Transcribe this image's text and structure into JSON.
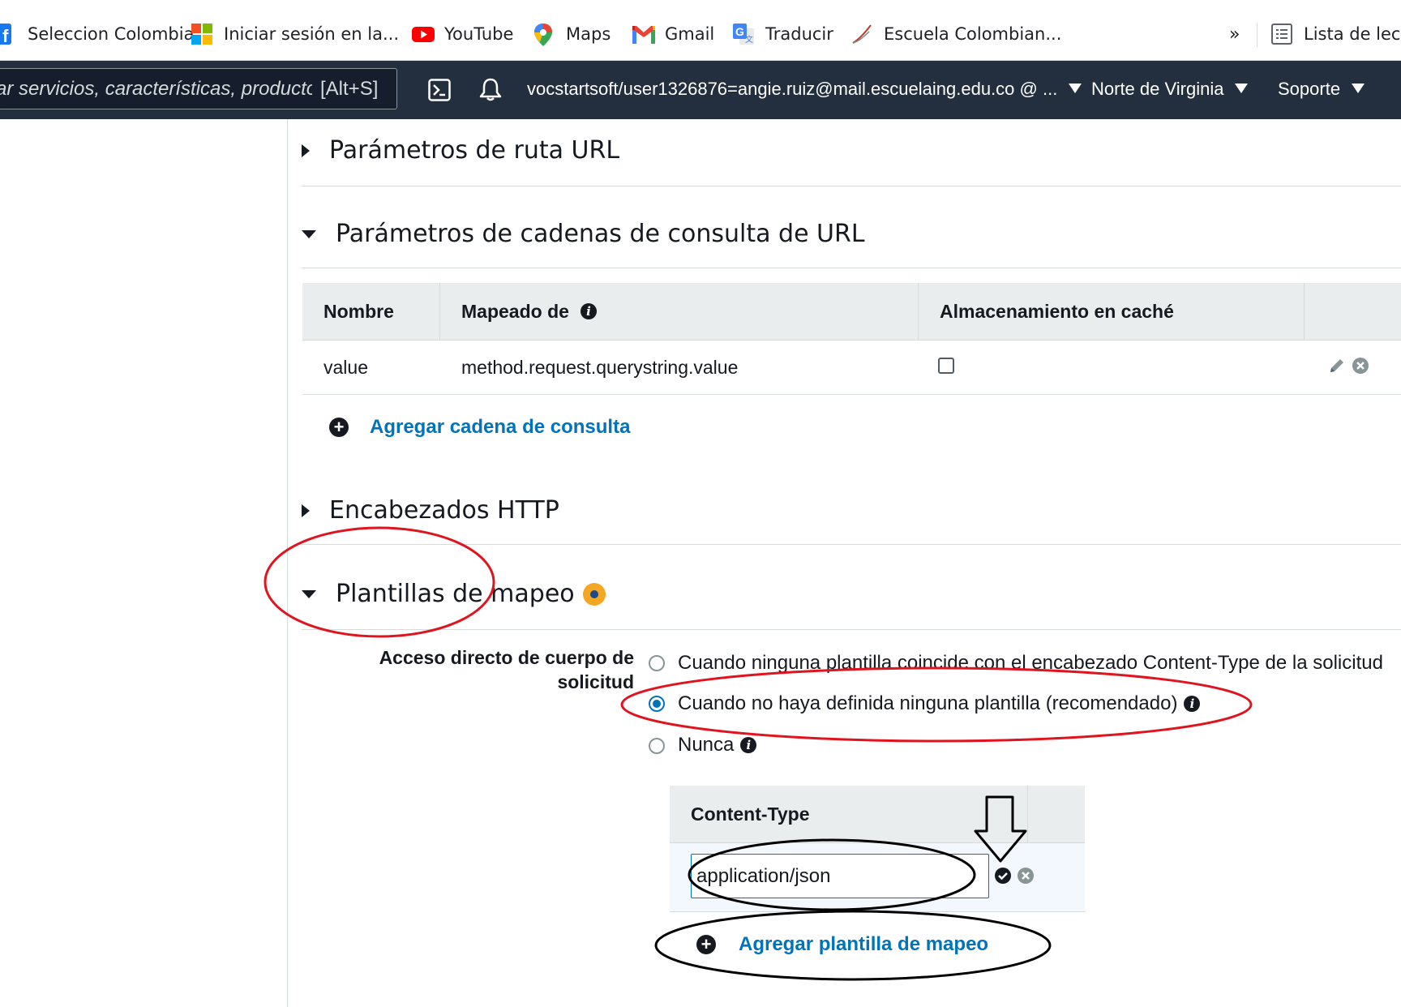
{
  "bookmarks": [
    {
      "label": "Seleccion Colombia",
      "icon": "facebook-icon"
    },
    {
      "label": "Iniciar sesión en la...",
      "icon": "microsoft-icon"
    },
    {
      "label": "YouTube",
      "icon": "youtube-icon"
    },
    {
      "label": "Maps",
      "icon": "maps-icon"
    },
    {
      "label": "Gmail",
      "icon": "gmail-icon"
    },
    {
      "label": "Traducir",
      "icon": "translate-icon"
    },
    {
      "label": "Escuela Colombian...",
      "icon": "escuela-icon"
    }
  ],
  "bookmarks_overflow": "»",
  "reading_list": "Lista de lectu",
  "aws_nav": {
    "search_placeholder": "ar servicios, características, producto",
    "search_shortcut": "[Alt+S]",
    "account": "vocstartsoft/user1326876=angie.ruiz@mail.escuelaing.edu.co @ ...",
    "region": "Norte de Virginia",
    "support": "Soporte"
  },
  "sections": {
    "path_params": "Parámetros de ruta URL",
    "query_params": "Parámetros de cadenas de consulta de URL",
    "http_headers": "Encabezados HTTP",
    "mapping_templates": "Plantillas de mapeo"
  },
  "query_table": {
    "headers": [
      "Nombre",
      "Mapeado de",
      "Almacenamiento en caché"
    ],
    "rows": [
      {
        "name": "value",
        "mapped_from": "method.request.querystring.value",
        "caching": false
      }
    ],
    "add_link": "Agregar cadena de consulta"
  },
  "passthrough": {
    "label_line1": "Acceso directo de cuerpo de",
    "label_line2": "solicitud",
    "options": [
      {
        "label": "Cuando ninguna plantilla coincide con el encabezado Content-Type de la solicitud",
        "selected": false
      },
      {
        "label": "Cuando no haya definida ninguna plantilla (recomendado)",
        "selected": true
      },
      {
        "label": "Nunca",
        "selected": false
      }
    ]
  },
  "content_type_table": {
    "header": "Content-Type",
    "input_value": "application/json",
    "add_link": "Agregar plantilla de mapeo"
  },
  "colors": {
    "aws_nav_bg": "#232f3e",
    "link": "#0073bb",
    "annotation_red": "#e0141e",
    "annotation_black": "#000000",
    "orange_dot": "#f5a623"
  }
}
